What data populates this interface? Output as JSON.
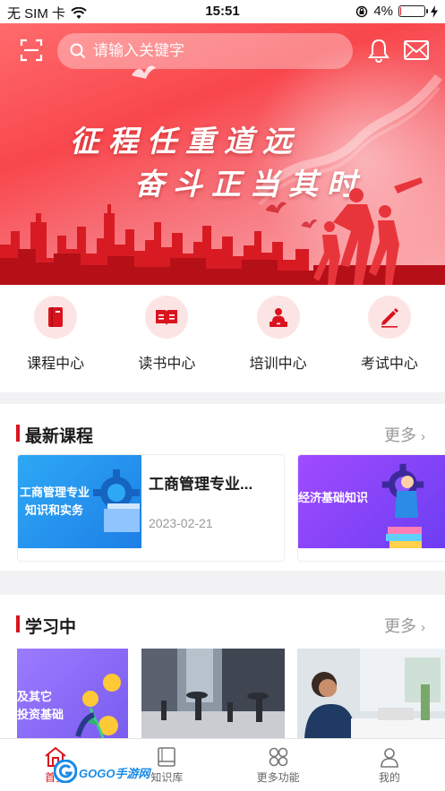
{
  "status_bar": {
    "carrier": "无 SIM 卡",
    "time": "15:51",
    "battery_percent": "4%",
    "battery_level": 0.04
  },
  "header": {
    "search_placeholder": "请输入关键字"
  },
  "banner": {
    "line1": "征程任重道远",
    "line2": "奋斗正当其时"
  },
  "categories": [
    {
      "label": "课程中心",
      "icon": "book-icon"
    },
    {
      "label": "读书中心",
      "icon": "open-book-icon"
    },
    {
      "label": "培训中心",
      "icon": "lecturer-icon"
    },
    {
      "label": "考试中心",
      "icon": "pencil-icon"
    }
  ],
  "latest_courses": {
    "title": "最新课程",
    "more": "更多",
    "items": [
      {
        "thumb_text_1": "工商管理专业",
        "thumb_text_2": "知识和实务",
        "title": "工商管理专业...",
        "date": "2023-02-21"
      },
      {
        "thumb_text_1": "经济基础知识"
      }
    ]
  },
  "studying": {
    "title": "学习中",
    "more": "更多",
    "items": [
      {
        "thumb_text_1": "及其它",
        "thumb_text_2": "投资基础"
      }
    ]
  },
  "tabbar": {
    "items": [
      {
        "label": "首页",
        "icon": "home-icon",
        "active": true
      },
      {
        "label": "知识库",
        "icon": "library-icon",
        "active": false
      },
      {
        "label": "更多功能",
        "icon": "grid-icon",
        "active": false
      },
      {
        "label": "我的",
        "icon": "user-icon",
        "active": false
      }
    ]
  },
  "watermark": "GOGO手游网",
  "colors": {
    "accent": "#d9141f",
    "banner": "#f8474c",
    "icon_bg": "#fde4e4"
  }
}
